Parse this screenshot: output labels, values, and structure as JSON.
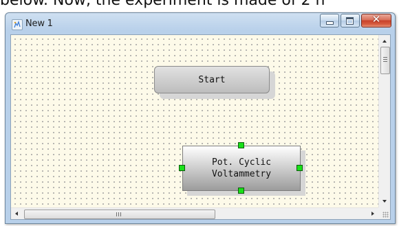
{
  "background": {
    "text": "below. Now, the experiment is made of 2 n"
  },
  "window": {
    "title": "New 1",
    "close_glyph": "✕"
  },
  "canvas": {
    "background_color": "#fdfae9",
    "blocks": [
      {
        "label": "Start"
      },
      {
        "label": "Pot. Cyclic\nVoltammetry",
        "selected": true
      }
    ],
    "handle_color": "#19e019"
  },
  "scrollbars": {
    "horizontal_grip": "III",
    "vertical_grip": "≡"
  }
}
